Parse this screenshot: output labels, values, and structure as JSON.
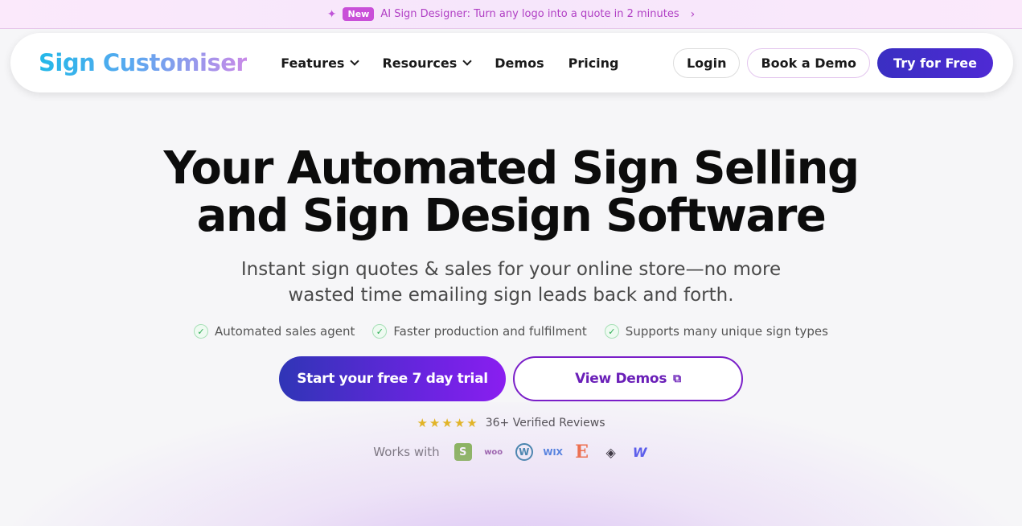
{
  "announcement": {
    "badge": "New",
    "text": "AI Sign Designer: Turn any logo into a quote in 2 minutes"
  },
  "nav": {
    "logo": "Sign Customiser",
    "items": [
      {
        "label": "Features",
        "dropdown": true
      },
      {
        "label": "Resources",
        "dropdown": true
      },
      {
        "label": "Demos",
        "dropdown": false
      },
      {
        "label": "Pricing",
        "dropdown": false
      }
    ],
    "login": "Login",
    "book_demo": "Book a Demo",
    "try_free": "Try for Free"
  },
  "hero": {
    "title_line1": "Your Automated Sign Selling",
    "title_line2": "and Sign Design Software",
    "subtitle": "Instant sign quotes & sales for your online store—no more wasted time emailing sign leads back and forth.",
    "checks": [
      "Automated sales agent",
      "Faster production and fulfilment",
      "Supports many unique sign types"
    ],
    "cta_primary": "Start your free 7 day trial",
    "cta_secondary": "View Demos",
    "reviews": "36+ Verified Reviews",
    "rating_stars": 5,
    "works_with": "Works with",
    "platforms": [
      "shopify-icon",
      "woocommerce-icon",
      "wordpress-icon",
      "wix-icon",
      "etsy-icon",
      "squarespace-icon",
      "webflow-icon"
    ]
  },
  "colors": {
    "primary": "#3a2fc2",
    "accent": "#7a1fc8",
    "announce_text": "#b03fc4",
    "check_green": "#2bab53",
    "star": "#e2b20c"
  }
}
